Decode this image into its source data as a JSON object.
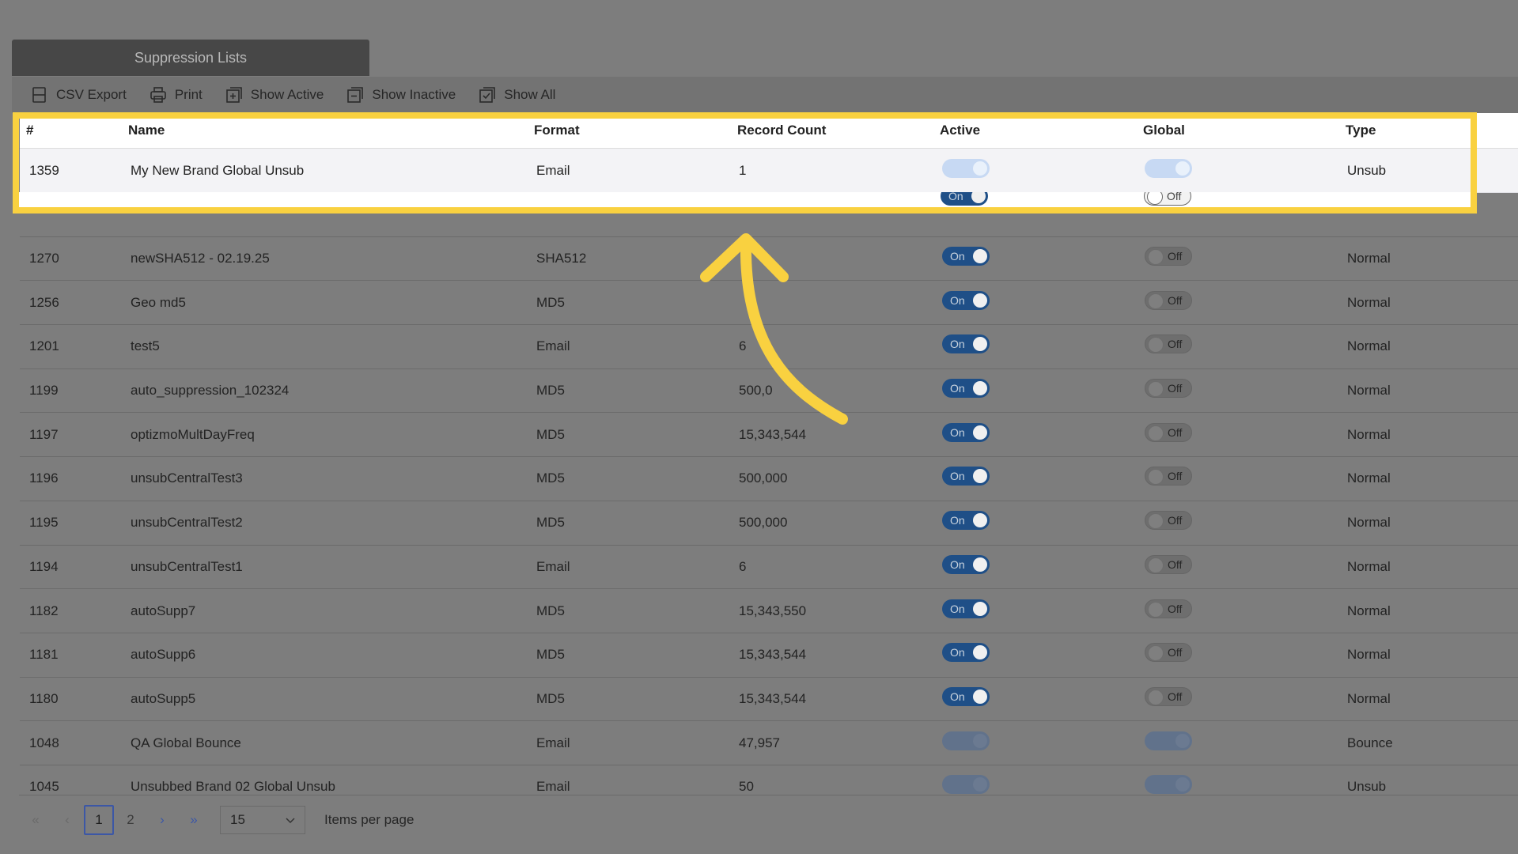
{
  "panel": {
    "title": "Suppression Lists"
  },
  "toolbar": {
    "items": [
      {
        "label": "CSV Export",
        "icon": "csv-export-icon"
      },
      {
        "label": "Print",
        "icon": "print-icon"
      },
      {
        "label": "Show Active",
        "icon": "show-active-icon"
      },
      {
        "label": "Show Inactive",
        "icon": "show-inactive-icon"
      },
      {
        "label": "Show All",
        "icon": "show-all-icon"
      }
    ]
  },
  "table": {
    "headers": [
      "#",
      "Name",
      "Format",
      "Record Count",
      "Active",
      "Global",
      "Type"
    ],
    "first_row": {
      "id": "1359",
      "name": "My New Brand Global Unsub",
      "format": "Email",
      "count": "1",
      "type": "Unsub"
    },
    "partial_row": {
      "active": "On",
      "global": "Off"
    },
    "rows": [
      {
        "id": "1270",
        "name": "newSHA512 - 02.19.25",
        "format": "SHA512",
        "count": "",
        "active": "On",
        "global": "Off",
        "type": "Normal"
      },
      {
        "id": "1256",
        "name": "Geo md5",
        "format": "MD5",
        "count": "",
        "active": "On",
        "global": "Off",
        "type": "Normal"
      },
      {
        "id": "1201",
        "name": "test5",
        "format": "Email",
        "count": "6",
        "active": "On",
        "global": "Off",
        "type": "Normal"
      },
      {
        "id": "1199",
        "name": "auto_suppression_102324",
        "format": "MD5",
        "count": "500,0",
        "active": "On",
        "global": "Off",
        "type": "Normal"
      },
      {
        "id": "1197",
        "name": "optizmoMultDayFreq",
        "format": "MD5",
        "count": "15,343,544",
        "active": "On",
        "global": "Off",
        "type": "Normal"
      },
      {
        "id": "1196",
        "name": "unsubCentralTest3",
        "format": "MD5",
        "count": "500,000",
        "active": "On",
        "global": "Off",
        "type": "Normal"
      },
      {
        "id": "1195",
        "name": "unsubCentralTest2",
        "format": "MD5",
        "count": "500,000",
        "active": "On",
        "global": "Off",
        "type": "Normal"
      },
      {
        "id": "1194",
        "name": "unsubCentralTest1",
        "format": "Email",
        "count": "6",
        "active": "On",
        "global": "Off",
        "type": "Normal"
      },
      {
        "id": "1182",
        "name": "autoSupp7",
        "format": "MD5",
        "count": "15,343,550",
        "active": "On",
        "global": "Off",
        "type": "Normal"
      },
      {
        "id": "1181",
        "name": "autoSupp6",
        "format": "MD5",
        "count": "15,343,544",
        "active": "On",
        "global": "Off",
        "type": "Normal"
      },
      {
        "id": "1180",
        "name": "autoSupp5",
        "format": "MD5",
        "count": "15,343,544",
        "active": "On",
        "global": "Off",
        "type": "Normal"
      },
      {
        "id": "1048",
        "name": "QA Global Bounce",
        "format": "Email",
        "count": "47,957",
        "active": "",
        "global": "",
        "type": "Bounce"
      },
      {
        "id": "1045",
        "name": "Unsubbed Brand 02 Global Unsub",
        "format": "Email",
        "count": "50",
        "active": "",
        "global": "",
        "type": "Unsub"
      }
    ]
  },
  "pager": {
    "first": "«",
    "prev": "‹",
    "pages": [
      "1",
      "2"
    ],
    "current": "1",
    "next": "›",
    "last": "»",
    "page_size": "15",
    "items_per_page_label": "Items per page"
  },
  "colors": {
    "highlight": "#f9d140",
    "toggle_on": "#1f4f87",
    "pager_accent": "#3c57a6"
  }
}
